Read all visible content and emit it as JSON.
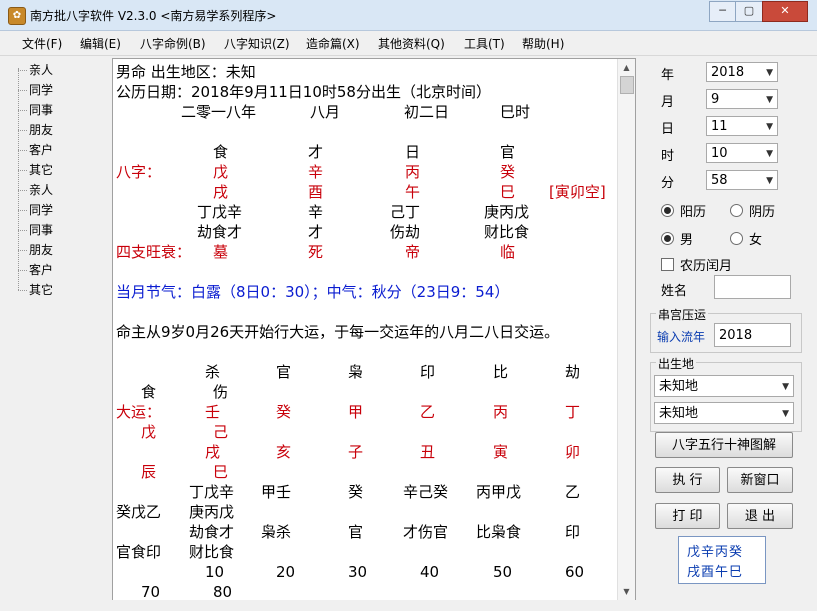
{
  "window": {
    "title": "南方批八字软件 V2.3.0   <南方易学系列程序>",
    "app_icon": "gear-icon",
    "controls": [
      "─",
      "▢",
      "✕"
    ]
  },
  "menu": [
    "文件(F)",
    "编辑(E)",
    "八字命例(B)",
    "八字知识(Z)",
    "造命篇(X)",
    "其他资料(Q)",
    "工具(T)",
    "帮助(H)"
  ],
  "tree": [
    "亲人",
    "同学",
    "同事",
    "朋友",
    "客户",
    "其它",
    "亲人",
    "同学",
    "同事",
    "朋友",
    "客户",
    "其它"
  ],
  "document": {
    "line1": "男命      出生地区：未知",
    "line2": "公历日期：2018年9月11日10时58分出生（北京时间）",
    "line3": [
      "二零一八年",
      "八月",
      "初二日",
      "巳时"
    ],
    "ten_gods_top": [
      "食",
      "才",
      "日",
      "官"
    ],
    "bazi_label": "八字：",
    "stems": [
      "戊",
      "辛",
      "丙",
      "癸"
    ],
    "branches": [
      "戌",
      "酉",
      "午",
      "巳"
    ],
    "kong": "[寅卯空]",
    "hidden_stems": [
      "丁戊辛",
      "辛",
      "己丁",
      "庚丙戊"
    ],
    "hidden_gods": [
      "劫食才",
      "才",
      "伤劫",
      "财比食"
    ],
    "phase_label": "四支旺衰：",
    "phases": [
      "墓",
      "死",
      "帝",
      "临"
    ],
    "jieqi": "当月节气：白露（8日0：30）；中气：秋分（23日9：54）",
    "yun_start": "命主从9岁0月26天开始行大运，于每一交运年的八月二八日交运。",
    "dayun_gods_row1": [
      "杀",
      "官",
      "枭",
      "印",
      "比",
      "劫"
    ],
    "dayun_gods_row1_cont": "食",
    "dayun_gods_row2": "伤",
    "dayun_label": "大运：",
    "dayun_stems": [
      "壬",
      "癸",
      "甲",
      "乙",
      "丙",
      "丁"
    ],
    "dayun_stems_cont": "戊",
    "dayun_stems_row2": "己",
    "dayun_branches": [
      "戌",
      "亥",
      "子",
      "丑",
      "寅",
      "卯"
    ],
    "dayun_branches_cont": "辰",
    "dayun_branches_row2": "巳",
    "dayun_hidden": [
      "丁戊辛",
      "甲壬",
      "癸",
      "辛己癸",
      "丙甲戊",
      "乙"
    ],
    "dayun_hidden_cont": "癸戊乙",
    "dayun_hidden_row2": "庚丙戊",
    "dayun_hgods": [
      "劫食才",
      "枭杀",
      "官",
      "才伤官",
      "比枭食",
      "印"
    ],
    "dayun_hgods_cont": "官食印",
    "dayun_hgods_row2": "财比食",
    "dayun_ages": [
      "10",
      "20",
      "30",
      "40",
      "50",
      "60"
    ],
    "dayun_ages_cont": "70",
    "dayun_ages_row2": "80"
  },
  "panel": {
    "year_label": "年",
    "year_value": "2018",
    "month_label": "月",
    "month_value": "9",
    "day_label": "日",
    "day_value": "11",
    "hour_label": "时",
    "hour_value": "10",
    "minute_label": "分",
    "minute_value": "58",
    "solar_label": "阳历",
    "lunar_label": "阴历",
    "male_label": "男",
    "female_label": "女",
    "leap_label": "农历闰月",
    "name_label": "姓名",
    "name_value": "",
    "liunian_group": "串宫压运",
    "liunian_label": "输入流年",
    "liunian_value": "2018",
    "birthplace_group": "出生地",
    "place1": "未知地",
    "place2": "未知地",
    "wuxing_button": "八字五行十神图解",
    "run_button": "执 行",
    "newwin_button": "新窗口",
    "print_button": "打 印",
    "exit_button": "退 出",
    "bazi_row1": "戊辛丙癸",
    "bazi_row2": "戌酉午巳"
  }
}
